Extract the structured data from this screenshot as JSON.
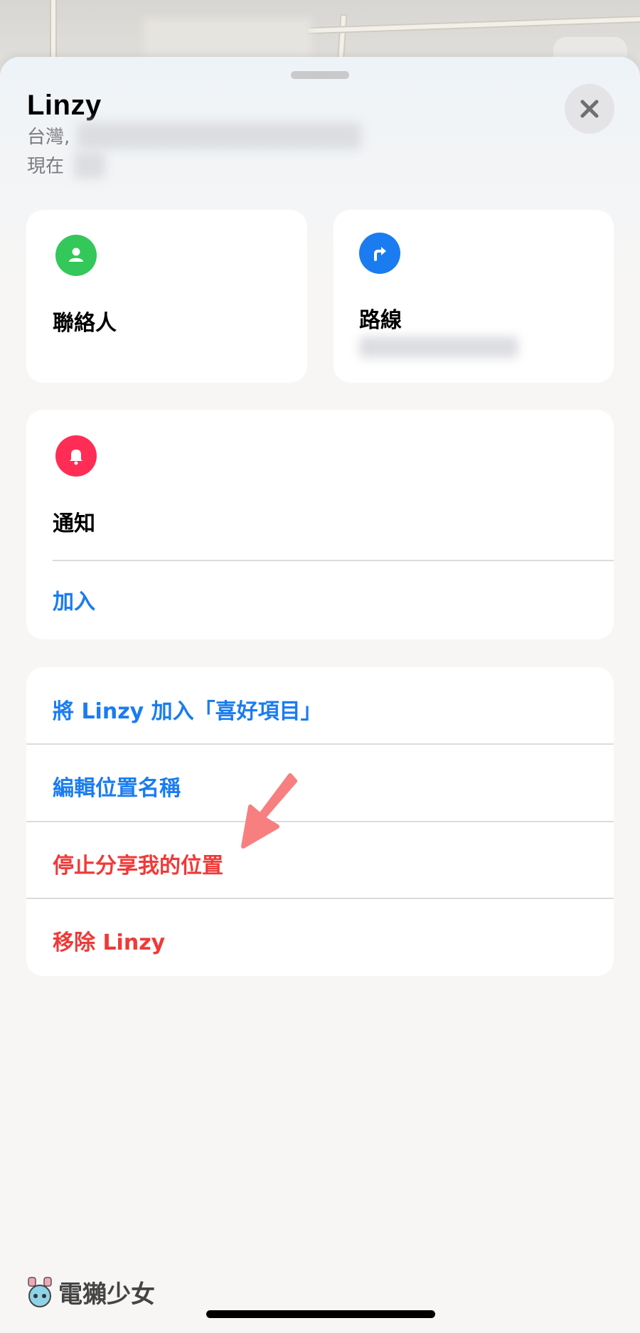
{
  "header": {
    "title": "Linzy",
    "location_prefix": "台灣,",
    "time_prefix": "現在"
  },
  "contact_card": {
    "label": "聯絡人",
    "icon": "person-icon",
    "icon_color": "#34c759"
  },
  "route_card": {
    "label": "路線",
    "icon": "turn-right-icon",
    "icon_color": "#1a7cf0"
  },
  "notify_card": {
    "label": "通知",
    "icon": "bell-icon",
    "icon_color": "#ff2d55",
    "add_label": "加入"
  },
  "actions": {
    "add_favorite": "將 Linzy 加入「喜好項目」",
    "edit_location_name": "編輯位置名稱",
    "stop_sharing": "停止分享我的位置",
    "remove": "移除 Linzy"
  },
  "watermark": {
    "text": "電獺少女"
  },
  "colors": {
    "accent_blue": "#1a7cf0",
    "destructive_red": "#ef3a38",
    "annotation_arrow": "#f87f7f"
  }
}
